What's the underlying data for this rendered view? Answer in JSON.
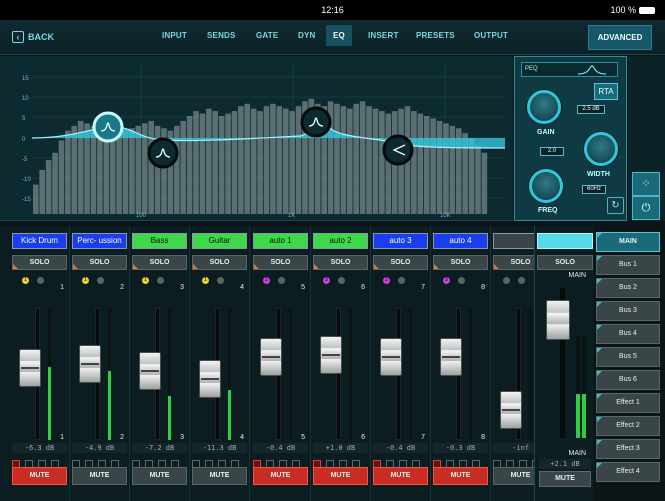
{
  "status": {
    "time": "12:16",
    "battery": "100 %"
  },
  "topbar": {
    "back_label": "BACK",
    "tabs": [
      "INPUT",
      "SENDS",
      "GATE",
      "DYN",
      "EQ",
      "INSERT",
      "PRESETS",
      "OUTPUT"
    ],
    "active_tab": "EQ",
    "advanced_label": "ADVANCED"
  },
  "eq": {
    "y_ticks": [
      "15",
      "10",
      "5",
      "0",
      "-5",
      "-10",
      "-15"
    ],
    "x_ticks": [
      "100",
      "1K",
      "10K"
    ],
    "colors": {
      "curve": "#2fc7dc",
      "rta_bars": "#9aa8aa",
      "node": "#0c2a30"
    },
    "panel": {
      "peq_label": "PEQ",
      "rta_label": "RTA",
      "gain_label": "GAIN",
      "gain_value": "2.5 dB",
      "width_label": "WIDTH",
      "width_value": "2.0",
      "freq_label": "FREQ",
      "freq_value": "60Hz"
    }
  },
  "channels": [
    {
      "name": "Kick Drum",
      "name_bg": "#1a3df0",
      "number": "1",
      "db": "-6.3 dB",
      "fader_level": 0.63,
      "meter_level": 0.55,
      "mute": true,
      "ind1_label": "1",
      "ind1_color": "#f0d030"
    },
    {
      "name": "Perc- ussion",
      "name_bg": "#1a3df0",
      "number": "2",
      "db": "-4.9 dB",
      "fader_level": 0.66,
      "meter_level": 0.52,
      "mute": false,
      "ind1_label": "1",
      "ind1_color": "#f0d030"
    },
    {
      "name": "Bass",
      "name_bg": "#3fd84a",
      "number": "3",
      "db": "-7.2 dB",
      "fader_level": 0.6,
      "meter_level": 0.33,
      "mute": false,
      "ind1_label": "1",
      "ind1_color": "#f0d030"
    },
    {
      "name": "Guitar",
      "name_bg": "#3fd84a",
      "number": "4",
      "db": "-11.3 dB",
      "fader_level": 0.53,
      "meter_level": 0.38,
      "mute": false,
      "ind1_label": "1",
      "ind1_color": "#f0d030"
    },
    {
      "name": "auto 1",
      "name_bg": "#3fd84a",
      "number": "5",
      "db": "-0.4 dB",
      "fader_level": 0.73,
      "meter_level": 0.0,
      "mute": true,
      "ind1_label": "2",
      "ind1_color": "#d040e0"
    },
    {
      "name": "auto 2",
      "name_bg": "#3fd84a",
      "number": "6",
      "db": "+1.0 dB",
      "fader_level": 0.75,
      "meter_level": 0.0,
      "mute": true,
      "ind1_label": "2",
      "ind1_color": "#d040e0"
    },
    {
      "name": "auto 3",
      "name_bg": "#1a3df0",
      "number": "7",
      "db": "-0.4 dB",
      "fader_level": 0.73,
      "meter_level": 0.0,
      "mute": true,
      "ind1_label": "2",
      "ind1_color": "#d040e0"
    },
    {
      "name": "auto 4",
      "name_bg": "#1a3df0",
      "number": "8",
      "db": "-0.3 dB",
      "fader_level": 0.73,
      "meter_level": 0.0,
      "mute": true,
      "ind1_label": "2",
      "ind1_color": "#d040e0"
    },
    {
      "name": "",
      "name_bg": "#3a4547",
      "number": "",
      "db": "-inf",
      "fader_level": 0.25,
      "meter_level": 0.0,
      "mute": false,
      "ind1_label": "",
      "ind1_color": "#5b6566"
    }
  ],
  "labels": {
    "solo": "SOLO",
    "mute": "MUTE"
  },
  "master": {
    "label": "MAIN",
    "db": "+2.1 dB",
    "solo": "SOLO",
    "mute": "MUTE"
  },
  "buses": [
    "MAIN",
    "Bus 1",
    "Bus 2",
    "Bus 3",
    "Bus 4",
    "Bus 5",
    "Bus 6",
    "Effect 1",
    "Effect 2",
    "Effect 3",
    "Effect 4"
  ],
  "active_bus": "MAIN"
}
